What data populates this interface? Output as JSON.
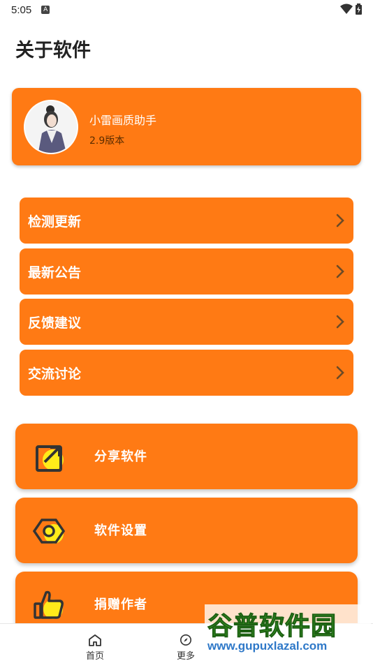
{
  "status_bar": {
    "time": "5:05",
    "notif_glyph": "A"
  },
  "header": {
    "title": "关于软件"
  },
  "app_card": {
    "name": "小雷画质助手",
    "version": "2.9版本"
  },
  "menu": [
    {
      "label": "检测更新"
    },
    {
      "label": "最新公告"
    },
    {
      "label": "反馈建议"
    },
    {
      "label": "交流讨论"
    }
  ],
  "cards": [
    {
      "label": "分享软件",
      "icon": "share-icon"
    },
    {
      "label": "软件设置",
      "icon": "settings-icon"
    },
    {
      "label": "捐赠作者",
      "icon": "thumbs-up-icon"
    }
  ],
  "bottom_nav": {
    "home": "首页",
    "more": "更多"
  },
  "watermark": {
    "main": "谷普软件园",
    "url": "www.gupuxlazal.com"
  },
  "colors": {
    "accent": "#FF7A14",
    "icon_yellow": "#FFEB1A",
    "icon_dark": "#333333"
  }
}
